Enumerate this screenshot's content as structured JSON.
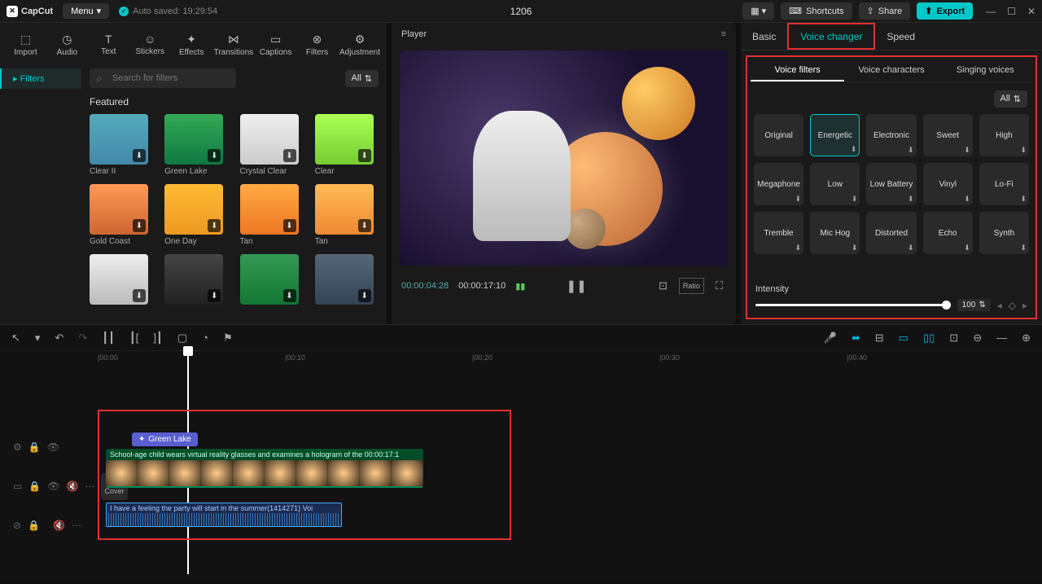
{
  "topbar": {
    "brand": "CapCut",
    "menu": "Menu",
    "autosave": "Auto saved: 19:29:54",
    "project_title": "1206",
    "shortcuts": "Shortcuts",
    "share": "Share",
    "export": "Export"
  },
  "tool_tabs": [
    "Import",
    "Audio",
    "Text",
    "Stickers",
    "Effects",
    "Transitions",
    "Captions",
    "Filters",
    "Adjustment"
  ],
  "sub_nav": "Filters",
  "search_placeholder": "Search for filters",
  "all_label": "All",
  "featured_label": "Featured",
  "filters": [
    {
      "name": "Clear II"
    },
    {
      "name": "Green Lake"
    },
    {
      "name": "Crystal Clear"
    },
    {
      "name": "Clear"
    },
    {
      "name": "Gold Coast"
    },
    {
      "name": "One Day"
    },
    {
      "name": "Tan"
    },
    {
      "name": "Tan"
    },
    {
      "name": ""
    },
    {
      "name": ""
    },
    {
      "name": ""
    },
    {
      "name": ""
    }
  ],
  "player": {
    "title": "Player",
    "tc_current": "00:00:04:28",
    "tc_total": "00:00:17:10",
    "ratio": "Ratio"
  },
  "rp_tabs": {
    "basic": "Basic",
    "voice_changer": "Voice changer",
    "speed": "Speed"
  },
  "vc_subtabs": {
    "filters": "Voice filters",
    "characters": "Voice characters",
    "singing": "Singing voices"
  },
  "vc_all": "All",
  "voice_filters": [
    "Original",
    "Energetic",
    "Electronic",
    "Sweet",
    "High",
    "Megaphone",
    "Low",
    "Low Battery",
    "Vinyl",
    "Lo-Fi",
    "Tremble",
    "Mic Hog",
    "Distorted",
    "Echo",
    "Synth"
  ],
  "intensity": {
    "label": "Intensity",
    "value": "100"
  },
  "ruler": [
    "|00:00",
    "|00:10",
    "|00:20",
    "|00:30",
    "|00:40"
  ],
  "clips": {
    "filter_label": "Green Lake",
    "video_label": "School-age child wears virtual reality glasses and examines a hologram of the   00:00:17:1",
    "audio_label": "I have a feeling the party will start in the summer(1414271)    Voi",
    "cover": "Cover"
  }
}
